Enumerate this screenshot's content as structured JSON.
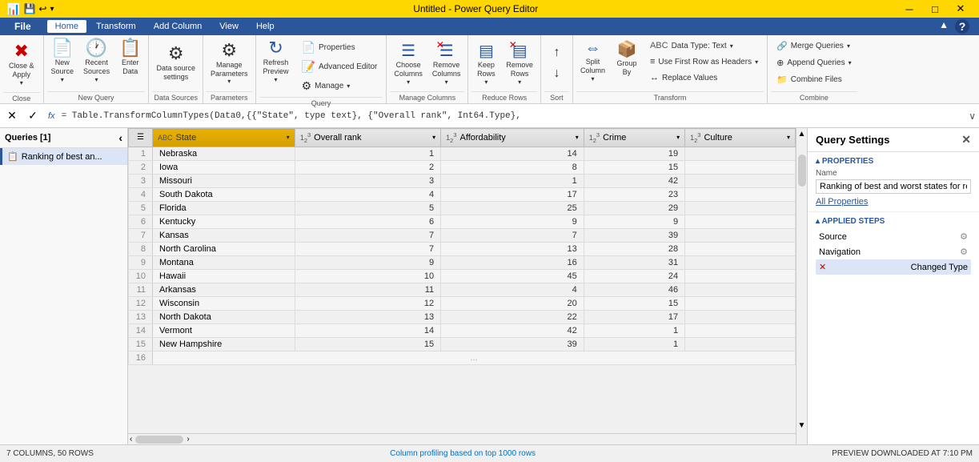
{
  "titleBar": {
    "icon": "📊",
    "title": "Untitled - Power Query Editor",
    "minimize": "─",
    "maximize": "□",
    "close": "✕"
  },
  "menuBar": {
    "items": [
      "File",
      "Home",
      "Transform",
      "Add Column",
      "View",
      "Help"
    ],
    "activeIndex": 1
  },
  "ribbon": {
    "groups": [
      {
        "label": "Close",
        "items": [
          {
            "id": "close-apply",
            "icon": "✖",
            "label": "Close &\nApply",
            "dropdown": true
          }
        ]
      },
      {
        "label": "New Query",
        "items": [
          {
            "id": "new-source",
            "icon": "📄",
            "label": "New\nSource",
            "dropdown": true
          },
          {
            "id": "recent-sources",
            "icon": "🕐",
            "label": "Recent\nSources",
            "dropdown": true
          },
          {
            "id": "enter-data",
            "icon": "📋",
            "label": "Enter\nData"
          }
        ]
      },
      {
        "label": "Data Sources",
        "items": [
          {
            "id": "data-source-settings",
            "icon": "⚙",
            "label": "Data source\nsettings"
          }
        ]
      },
      {
        "label": "Parameters",
        "items": [
          {
            "id": "manage-parameters",
            "icon": "⚙",
            "label": "Manage\nParameters",
            "dropdown": true
          }
        ]
      },
      {
        "label": "Query",
        "items": [
          {
            "id": "refresh-preview",
            "icon": "↻",
            "label": "Refresh\nPreview",
            "dropdown": true
          },
          {
            "id": "properties",
            "icon": "📄",
            "label": "Properties"
          },
          {
            "id": "advanced-editor",
            "icon": "📝",
            "label": "Advanced Editor"
          },
          {
            "id": "manage",
            "icon": "⚙",
            "label": "Manage",
            "dropdown": true
          }
        ]
      },
      {
        "label": "Manage Columns",
        "items": [
          {
            "id": "choose-columns",
            "icon": "☰",
            "label": "Choose\nColumns",
            "dropdown": true
          },
          {
            "id": "remove-columns",
            "icon": "✖☰",
            "label": "Remove\nColumns",
            "dropdown": true
          }
        ]
      },
      {
        "label": "Reduce Rows",
        "items": [
          {
            "id": "keep-rows",
            "icon": "▣",
            "label": "Keep\nRows",
            "dropdown": true
          },
          {
            "id": "remove-rows",
            "icon": "✖▣",
            "label": "Remove\nRows",
            "dropdown": true
          }
        ]
      },
      {
        "label": "Sort",
        "items": [
          {
            "id": "sort-asc",
            "icon": "↑",
            "label": ""
          },
          {
            "id": "sort-desc",
            "icon": "↓",
            "label": ""
          }
        ]
      },
      {
        "label": "Transform",
        "items": [
          {
            "id": "split-column",
            "icon": "⇔",
            "label": "Split\nColumn",
            "dropdown": true
          },
          {
            "id": "group-by",
            "icon": "📦",
            "label": "Group\nBy"
          },
          {
            "id": "data-type",
            "label": "Data Type: Text",
            "dropdown": true
          },
          {
            "id": "first-row-headers",
            "label": "Use First Row as Headers",
            "dropdown": true
          },
          {
            "id": "replace-values",
            "label": "Replace Values"
          }
        ]
      },
      {
        "label": "Combine",
        "items": [
          {
            "id": "merge-queries",
            "label": "Merge Queries",
            "dropdown": true
          },
          {
            "id": "append-queries",
            "label": "Append Queries",
            "dropdown": true
          },
          {
            "id": "combine-files",
            "label": "Combine Files"
          }
        ]
      }
    ]
  },
  "formulaBar": {
    "cancelLabel": "✕",
    "confirmLabel": "✓",
    "fxLabel": "fx",
    "formula": "= Table.TransformColumnTypes(Data0,{{\"State\", type text}, {\"Overall rank\", Int64.Type},",
    "expandIcon": "∨"
  },
  "queryPanel": {
    "title": "Queries [1]",
    "collapseIcon": "‹",
    "items": [
      {
        "id": "ranking",
        "icon": "📋",
        "label": "Ranking of best an..."
      }
    ]
  },
  "table": {
    "columns": [
      {
        "id": "row-num",
        "label": "",
        "type": ""
      },
      {
        "id": "state",
        "label": "State",
        "type": "ABC"
      },
      {
        "id": "overall-rank",
        "label": "Overall rank",
        "type": "123"
      },
      {
        "id": "affordability",
        "label": "Affordability",
        "type": "123"
      },
      {
        "id": "crime",
        "label": "Crime",
        "type": "123"
      },
      {
        "id": "culture",
        "label": "Culture",
        "type": "123"
      }
    ],
    "rows": [
      {
        "num": 1,
        "state": "Nebraska",
        "overall_rank": 1,
        "affordability": 14,
        "crime": 19,
        "culture": ""
      },
      {
        "num": 2,
        "state": "Iowa",
        "overall_rank": 2,
        "affordability": 8,
        "crime": 15,
        "culture": ""
      },
      {
        "num": 3,
        "state": "Missouri",
        "overall_rank": 3,
        "affordability": 1,
        "crime": 42,
        "culture": ""
      },
      {
        "num": 4,
        "state": "South Dakota",
        "overall_rank": 4,
        "affordability": 17,
        "crime": 23,
        "culture": ""
      },
      {
        "num": 5,
        "state": "Florida",
        "overall_rank": 5,
        "affordability": 25,
        "crime": 29,
        "culture": ""
      },
      {
        "num": 6,
        "state": "Kentucky",
        "overall_rank": 6,
        "affordability": 9,
        "crime": 9,
        "culture": ""
      },
      {
        "num": 7,
        "state": "Kansas",
        "overall_rank": 7,
        "affordability": 7,
        "crime": 39,
        "culture": ""
      },
      {
        "num": 8,
        "state": "North Carolina",
        "overall_rank": 7,
        "affordability": 13,
        "crime": 28,
        "culture": ""
      },
      {
        "num": 9,
        "state": "Montana",
        "overall_rank": 9,
        "affordability": 16,
        "crime": 31,
        "culture": ""
      },
      {
        "num": 10,
        "state": "Hawaii",
        "overall_rank": 10,
        "affordability": 45,
        "crime": 24,
        "culture": ""
      },
      {
        "num": 11,
        "state": "Arkansas",
        "overall_rank": 11,
        "affordability": 4,
        "crime": 46,
        "culture": ""
      },
      {
        "num": 12,
        "state": "Wisconsin",
        "overall_rank": 12,
        "affordability": 20,
        "crime": 15,
        "culture": ""
      },
      {
        "num": 13,
        "state": "North Dakota",
        "overall_rank": 13,
        "affordability": 22,
        "crime": 17,
        "culture": ""
      },
      {
        "num": 14,
        "state": "Vermont",
        "overall_rank": 14,
        "affordability": 42,
        "crime": 1,
        "culture": ""
      },
      {
        "num": 15,
        "state": "New Hampshire",
        "overall_rank": 15,
        "affordability": 39,
        "crime": 1,
        "culture": ""
      },
      {
        "num": 16,
        "state": "...",
        "overall_rank": null,
        "affordability": null,
        "crime": null,
        "culture": null
      }
    ]
  },
  "querySettings": {
    "title": "Query Settings",
    "closeIcon": "✕",
    "propertiesLabel": "PROPERTIES",
    "nameLabel": "Name",
    "nameValue": "Ranking of best and worst states for retire",
    "allPropertiesLabel": "All Properties",
    "appliedStepsLabel": "APPLIED STEPS",
    "steps": [
      {
        "id": "source",
        "label": "Source",
        "hasGear": true,
        "hasError": false,
        "active": false
      },
      {
        "id": "navigation",
        "label": "Navigation",
        "hasGear": true,
        "hasError": false,
        "active": false
      },
      {
        "id": "changed-type",
        "label": "Changed Type",
        "hasGear": false,
        "hasError": true,
        "active": true
      }
    ]
  },
  "statusBar": {
    "leftText": "7 COLUMNS, 50 ROWS",
    "centerText": "Column profiling based on top 1000 rows",
    "rightText": "PREVIEW DOWNLOADED AT 7:10 PM"
  }
}
